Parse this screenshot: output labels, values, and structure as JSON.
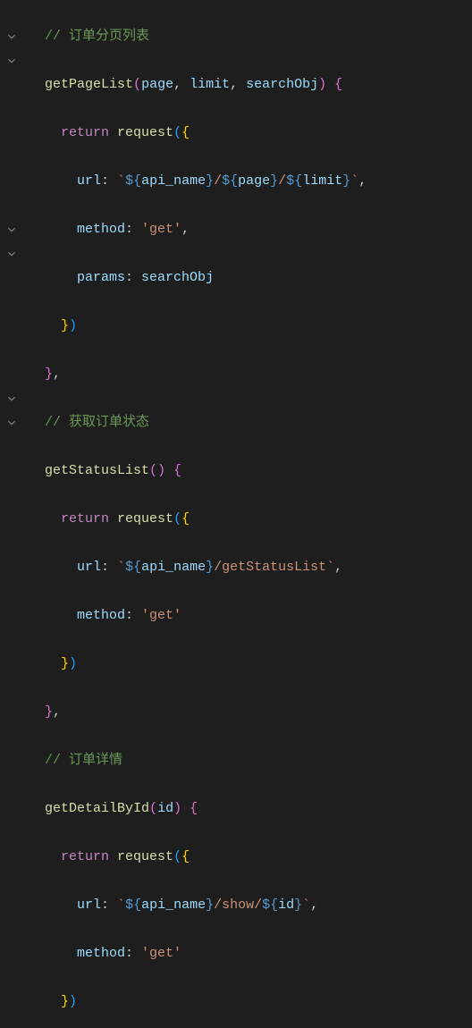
{
  "code": {
    "comment1": "// 订单分页列表",
    "func1": "getPageList",
    "p1a": "page",
    "p1b": "limit",
    "p1c": "searchObj",
    "kw_return": "return",
    "request": "request",
    "url_label": "url",
    "method_label": "method",
    "params_label": "params",
    "api_name": "api_name",
    "str_get": "'get'",
    "page_ref": "page",
    "limit_ref": "limit",
    "searchObj_ref": "searchObj",
    "comment2": "// 获取订单状态",
    "func2": "getStatusList",
    "getStatusList_path": "/getStatusList",
    "comment3": "// 订单详情",
    "func3": "getDetailById",
    "p3a": "id",
    "show_path": "/show/",
    "id_ref": "id"
  },
  "glyphs": {
    "backtick": "`",
    "dollar_open": "${",
    "close_brace": "}",
    "open_paren": "(",
    "close_paren": ")",
    "open_curly": "{",
    "close_curly_paren": "})",
    "close_curly_comma": "},",
    "comma": ",",
    "comma_sp": ", ",
    "colon_sp": ": ",
    "slash": "/",
    "space": " "
  }
}
